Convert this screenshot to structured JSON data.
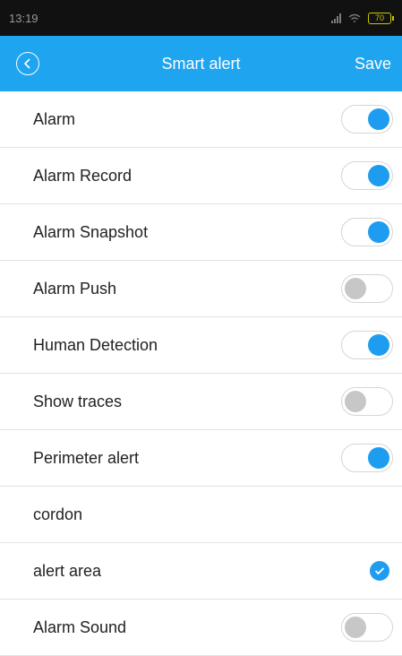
{
  "status_bar": {
    "time": "13:19",
    "battery": "70"
  },
  "header": {
    "title": "Smart alert",
    "save_label": "Save"
  },
  "colors": {
    "accent": "#1e9df0",
    "header_bg": "#1fa4ef",
    "toggle_off": "#c7c7c7"
  },
  "rows": [
    {
      "label": "Alarm",
      "control": "toggle",
      "on": true
    },
    {
      "label": "Alarm Record",
      "control": "toggle",
      "on": true
    },
    {
      "label": "Alarm Snapshot",
      "control": "toggle",
      "on": true
    },
    {
      "label": "Alarm Push",
      "control": "toggle",
      "on": false
    },
    {
      "label": "Human Detection",
      "control": "toggle",
      "on": true
    },
    {
      "label": "Show traces",
      "control": "toggle",
      "on": false
    },
    {
      "label": "Perimeter alert",
      "control": "toggle",
      "on": true
    },
    {
      "label": "cordon",
      "control": "none"
    },
    {
      "label": "alert area",
      "control": "check",
      "checked": true
    },
    {
      "label": "Alarm Sound",
      "control": "toggle",
      "on": false
    }
  ]
}
